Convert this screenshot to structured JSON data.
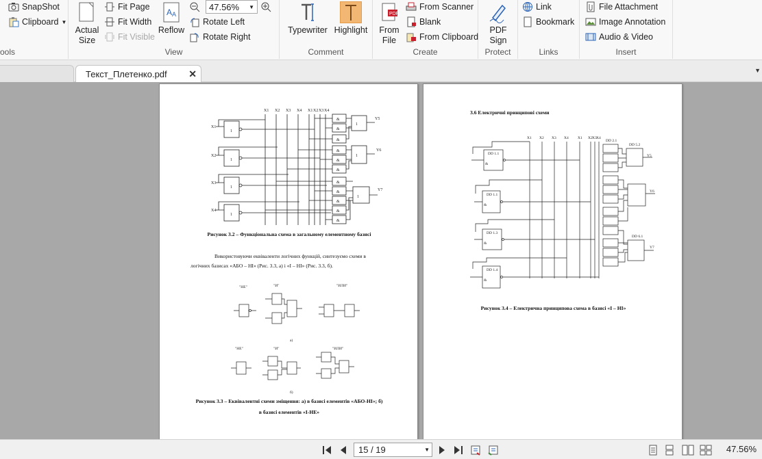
{
  "ribbon": {
    "tools_group": {
      "snapshot": "SnapShot",
      "clipboard": "Clipboard",
      "title": "ools"
    },
    "view_group": {
      "actual_size_line1": "Actual",
      "actual_size_line2": "Size",
      "fit_page": "Fit Page",
      "fit_width": "Fit Width",
      "fit_visible": "Fit Visible",
      "reflow": "Reflow",
      "zoom_value": "47.56%",
      "rotate_left": "Rotate Left",
      "rotate_right": "Rotate Right",
      "title": "View"
    },
    "comment_group": {
      "typewriter": "Typewriter",
      "highlight": "Highlight",
      "title": "Comment"
    },
    "create_group": {
      "from_file_line1": "From",
      "from_file_line2": "File",
      "from_scanner": "From Scanner",
      "blank": "Blank",
      "from_clipboard": "From Clipboard",
      "title": "Create"
    },
    "protect_group": {
      "pdf_sign_line1": "PDF",
      "pdf_sign_line2": "Sign",
      "title": "Protect"
    },
    "links_group": {
      "link": "Link",
      "bookmark": "Bookmark",
      "title": "Links"
    },
    "insert_group": {
      "file_attachment": "File Attachment",
      "image_annotation": "Image Annotation",
      "audio_video": "Audio & Video",
      "title": "Insert"
    }
  },
  "tabs": {
    "active": "Текст_Плетенко.pdf"
  },
  "document": {
    "left_page": {
      "fig32_caption": "Рисунок 3.2 – Функціональна схема в загальному елементному базисі",
      "para_line1": "Використовуючи еквіваленти логічних функцій, синтезуємо схеми в",
      "para_line2": "логічних базисах «АБО – НІ» (Рис. 3.3, а) і «І – НІ» (Рис. 3.3, б).",
      "fig33_caption_line1": "Рисунок 3.3 – Еквівалентні схеми зміщення: а) в базисі елементів «АБО-НІ»; б)",
      "fig33_caption_line2": "в базисі елементів «І-НЕ»",
      "inputs": [
        "X1",
        "X2",
        "X3",
        "X4"
      ],
      "outputs": [
        "Y5",
        "Y6",
        "Y7"
      ],
      "bus": [
        "X1",
        "X2",
        "X3",
        "X4",
        "X1",
        "X2",
        "X3",
        "X4"
      ],
      "sub_labels": [
        "а)",
        "б)"
      ],
      "eq_labels_top": [
        "\"НЕ\"",
        "\"И\"",
        "\"ИЛИ\""
      ],
      "eq_labels_bottom": [
        "\"НЕ\"",
        "\"И\"",
        "\"ИЛИ\""
      ]
    },
    "right_page": {
      "section_title": "3.6 Електричні принципові схеми",
      "fig34_caption": "Рисунок 3.4 – Електрична принципова схема в базисі «І – НІ»",
      "bus": [
        "X1",
        "X2",
        "X3",
        "X4",
        "X1",
        "X2",
        "X3",
        "X4"
      ],
      "chips": [
        "DD 1.1",
        "DD 1.1",
        "DD 1.3",
        "DD 1.4"
      ],
      "outputs": [
        "Y5",
        "Y6",
        "Y7"
      ],
      "out_chips": [
        "DD 5.2",
        "DD 5.1",
        "DD 6.1"
      ]
    }
  },
  "statusbar": {
    "page_indicator": "15 / 19",
    "zoom": "47.56%"
  },
  "colors": {
    "accent_orange": "#f5a623",
    "link_blue": "#1f5fae",
    "pdf_red": "#c8202c"
  }
}
